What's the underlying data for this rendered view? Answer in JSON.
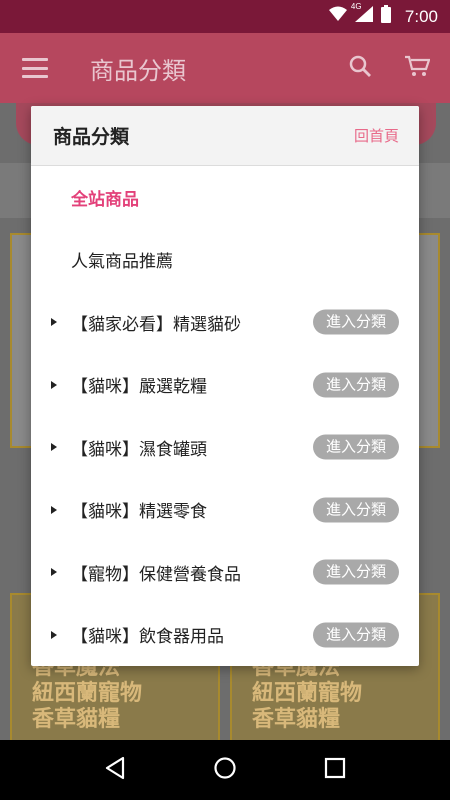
{
  "status_bar": {
    "network": "4G",
    "time": "7:00",
    "icons": [
      "wifi-icon",
      "signal-icon",
      "battery-icon"
    ]
  },
  "app_bar": {
    "title": "商品分類",
    "icons": [
      "menu-icon",
      "search-icon",
      "cart-icon"
    ]
  },
  "background": {
    "promo_text_left": [
      "香草魔法",
      "紐西蘭寵物",
      "香草貓糧"
    ],
    "promo_text_right": [
      "香草魔法",
      "紐西蘭寵物",
      "香草貓糧"
    ]
  },
  "dialog": {
    "title": "商品分類",
    "home_link": "回首頁",
    "items": [
      {
        "label": "全站商品",
        "active": true,
        "has_arrow": false,
        "button": null
      },
      {
        "label": "人氣商品推薦",
        "active": false,
        "has_arrow": false,
        "button": null
      },
      {
        "label": "【貓家必看】精選貓砂",
        "active": false,
        "has_arrow": true,
        "button": "進入分類"
      },
      {
        "label": "【貓咪】嚴選乾糧",
        "active": false,
        "has_arrow": true,
        "button": "進入分類"
      },
      {
        "label": "【貓咪】濕食罐頭",
        "active": false,
        "has_arrow": true,
        "button": "進入分類"
      },
      {
        "label": "【貓咪】精選零食",
        "active": false,
        "has_arrow": true,
        "button": "進入分類"
      },
      {
        "label": "【寵物】保健營養食品",
        "active": false,
        "has_arrow": true,
        "button": "進入分類"
      },
      {
        "label": "【貓咪】飲食器用品",
        "active": false,
        "has_arrow": true,
        "button": "進入分類"
      }
    ]
  },
  "nav_bar": {
    "icons": [
      "back-icon",
      "home-icon",
      "recents-icon"
    ]
  },
  "colors": {
    "status_bar": "#7a1838",
    "app_bar_dimmed": "#b6475e",
    "active_category": "#e3417a",
    "home_link": "#e86a8a",
    "enter_button": "#a9a9a9"
  }
}
